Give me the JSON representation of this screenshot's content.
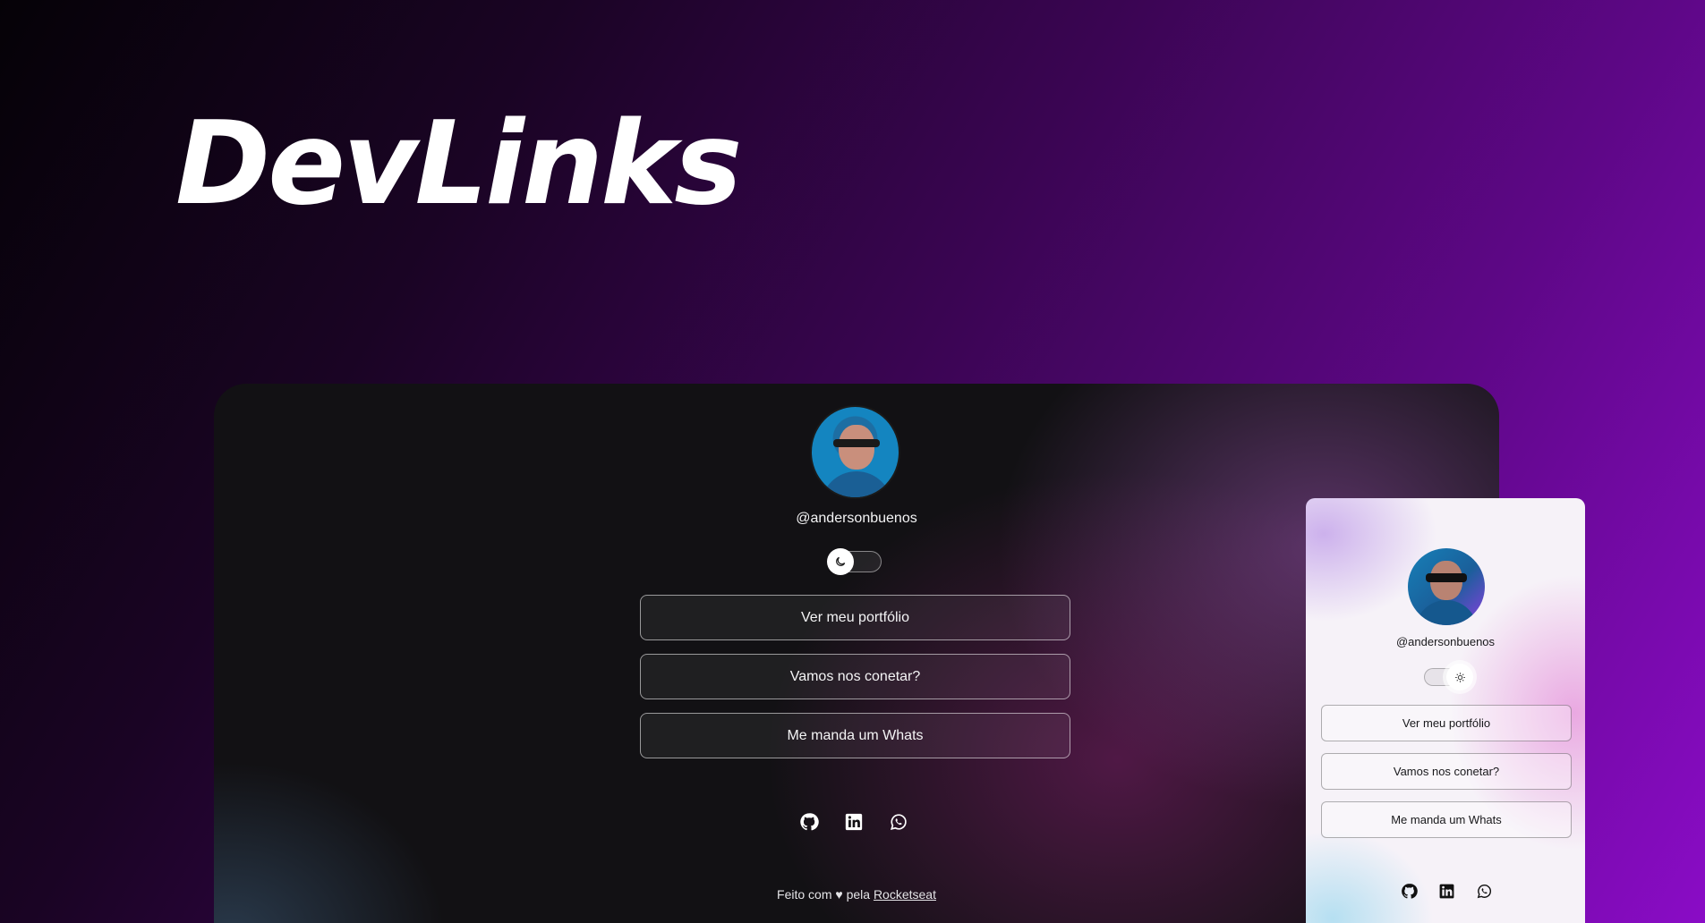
{
  "hero": {
    "title": "DevLinks"
  },
  "desktop": {
    "handle": "@andersonbuenos",
    "theme_toggle": {
      "state": "dark",
      "icon": "moon-icon"
    },
    "links": [
      {
        "label": "Ver meu portfólio"
      },
      {
        "label": "Vamos nos conetar?"
      },
      {
        "label": "Me manda um Whats"
      }
    ],
    "social": [
      "github-icon",
      "linkedin-icon",
      "whatsapp-icon"
    ],
    "footer": {
      "prefix": "Feito com ♥ pela",
      "link": "Rocketseat"
    }
  },
  "mobile": {
    "handle": "@andersonbuenos",
    "theme_toggle": {
      "state": "light",
      "icon": "sun-icon"
    },
    "links": [
      {
        "label": "Ver meu portfólio"
      },
      {
        "label": "Vamos nos conetar?"
      },
      {
        "label": "Me manda um Whats"
      }
    ],
    "social": [
      "github-icon",
      "linkedin-icon",
      "whatsapp-icon"
    ]
  },
  "colors": {
    "bg_start": "#050207",
    "bg_end": "#8a0cc6",
    "desktop_card": "#121114",
    "mobile_card": "#f6f2f8"
  }
}
